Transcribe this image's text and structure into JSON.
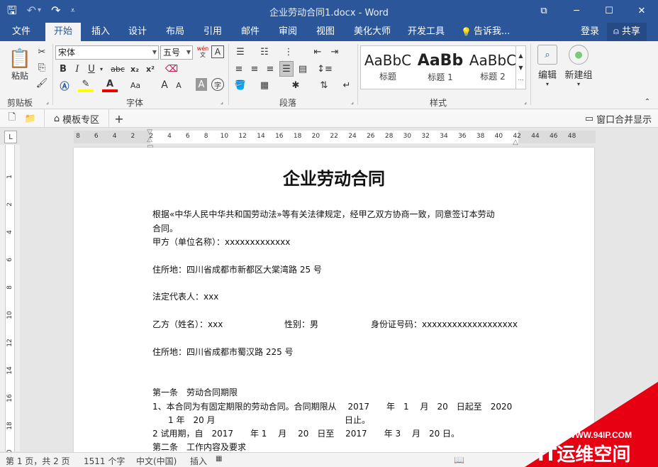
{
  "window": {
    "title": "企业劳动合同1.docx - Word",
    "qat": {
      "save": "🖫",
      "undo": "↶",
      "undo_more": "▾",
      "redo": "↷",
      "customize": "⩡"
    },
    "controls": {
      "ribbon_opts": "⧉",
      "minimize": "─",
      "maximize": "☐",
      "close": "✕"
    }
  },
  "tabs": {
    "file": "文件",
    "home": "开始",
    "insert": "插入",
    "design": "设计",
    "layout": "布局",
    "references": "引用",
    "mailings": "邮件",
    "review": "审阅",
    "view": "视图",
    "beautify": "美化大师",
    "developer": "开发工具",
    "tellme": "告诉我...",
    "login": "登录",
    "share": "共享"
  },
  "ribbon": {
    "clipboard": {
      "paste": "粘贴",
      "label": "剪贴板"
    },
    "font": {
      "name": "宋体",
      "size": "五号",
      "wen": "wén",
      "label": "字体",
      "bold": "B",
      "italic": "I",
      "underline": "U",
      "strike": "abc",
      "sub": "x₂",
      "sup": "x²",
      "grow": "A",
      "shrink": "A",
      "aa": "Aa",
      "char_shade": "A",
      "enclose": "字"
    },
    "paragraph": {
      "label": "段落"
    },
    "styles": {
      "label": "样式",
      "items": [
        {
          "preview": "AaBbC",
          "name": "标题"
        },
        {
          "preview": "AaBb",
          "name": "标题 1"
        },
        {
          "preview": "AaBbC",
          "name": "标题 2"
        }
      ]
    },
    "edit": {
      "label": "编辑"
    },
    "new_group": {
      "label": "新建组"
    }
  },
  "docbar": {
    "template_zone": "模板专区",
    "add": "+",
    "merge": "窗口合并显示"
  },
  "ruler": {
    "h_ticks": [
      "8",
      "6",
      "4",
      "2",
      "2",
      "4",
      "6",
      "8",
      "10",
      "12",
      "14",
      "16",
      "18",
      "20",
      "22",
      "24",
      "26",
      "28",
      "30",
      "32",
      "34",
      "36",
      "38",
      "40",
      "42",
      "44",
      "46",
      "48"
    ],
    "v_ticks": [
      "1",
      "2",
      "4",
      "6",
      "8",
      "10",
      "12",
      "14",
      "16",
      "18",
      "20"
    ]
  },
  "document": {
    "title": "企业劳动合同",
    "lines": [
      "根据«中华人民中华共和国劳动法»等有关法律规定，经甲乙双方协商一致，同意签订本劳动",
      "合同。",
      "甲方（单位名称）：xxxxxxxxxxxxx",
      "住所地：四川省成都市新都区大棠湾路 25 号",
      "法定代表人：xxx",
      "乙方（姓名）：xxx",
      "性别：男",
      "身份证号码：xxxxxxxxxxxxxxxxxxx",
      "住所地：四川省成都市蜀汉路 225 号",
      "第一条　劳动合同期限",
      "1、本合同为有固定期限的劳动合同。合同期限从　 2017　　年　1　 月　20　日起至　2020",
      "1 年　20 月",
      "日止。",
      "2 试用期，自　2017　　年 1　 月　 20　日至　 2017　　年 3　 月　20 日。",
      "第二条　工作内容及要求"
    ]
  },
  "status": {
    "page": "第 1 页，共 2 页",
    "words": "1511 个字",
    "lang": "中文(中国)",
    "mode": "插入"
  },
  "watermark": {
    "url": "WWW.94IP.COM",
    "brand": "IT运维空间"
  }
}
